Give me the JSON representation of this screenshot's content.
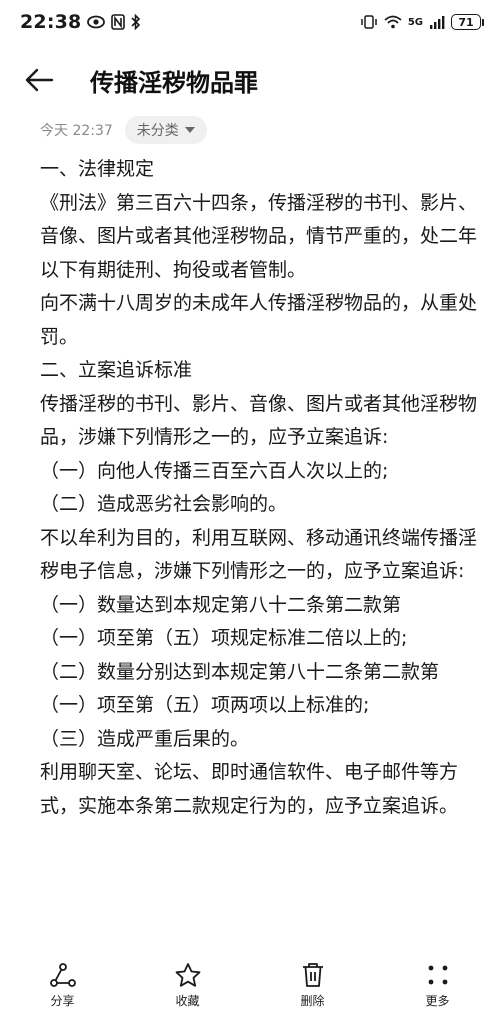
{
  "status_bar": {
    "time": "22:38",
    "signal_label": "5G",
    "battery": "71"
  },
  "header": {
    "title": "传播淫秽物品罪"
  },
  "meta": {
    "date": "今天 22:37",
    "category": "未分类"
  },
  "note": {
    "lines": [
      "一、法律规定",
      "《刑法》第三百六十四条，传播淫秽的书刊、影片、音像、图片或者其他淫秽物品，情节严重的，处二年以下有期徒刑、拘役或者管制。",
      "向不满十八周岁的未成年人传播淫秽物品的，从重处罚。",
      "二、立案追诉标准",
      "传播淫秽的书刊、影片、音像、图片或者其他淫秽物品，涉嫌下列情形之一的，应予立案追诉:",
      "（一）向他人传播三百至六百人次以上的;",
      "（二）造成恶劣社会影响的。",
      "不以牟利为目的，利用互联网、移动通讯终端传播淫秽电子信息，涉嫌下列情形之一的，应予立案追诉:",
      "（一）数量达到本规定第八十二条第二款第",
      "（一）项至第（五）项规定标准二倍以上的;",
      "（二）数量分别达到本规定第八十二条第二款第（一）项至第（五）项两项以上标准的;",
      "（三）造成严重后果的。",
      "利用聊天室、论坛、即时通信软件、电子邮件等方式，实施本条第二款规定行为的，应予立案追诉。"
    ]
  },
  "bottom_bar": {
    "share": "分享",
    "favorite": "收藏",
    "delete": "删除",
    "more": "更多"
  }
}
